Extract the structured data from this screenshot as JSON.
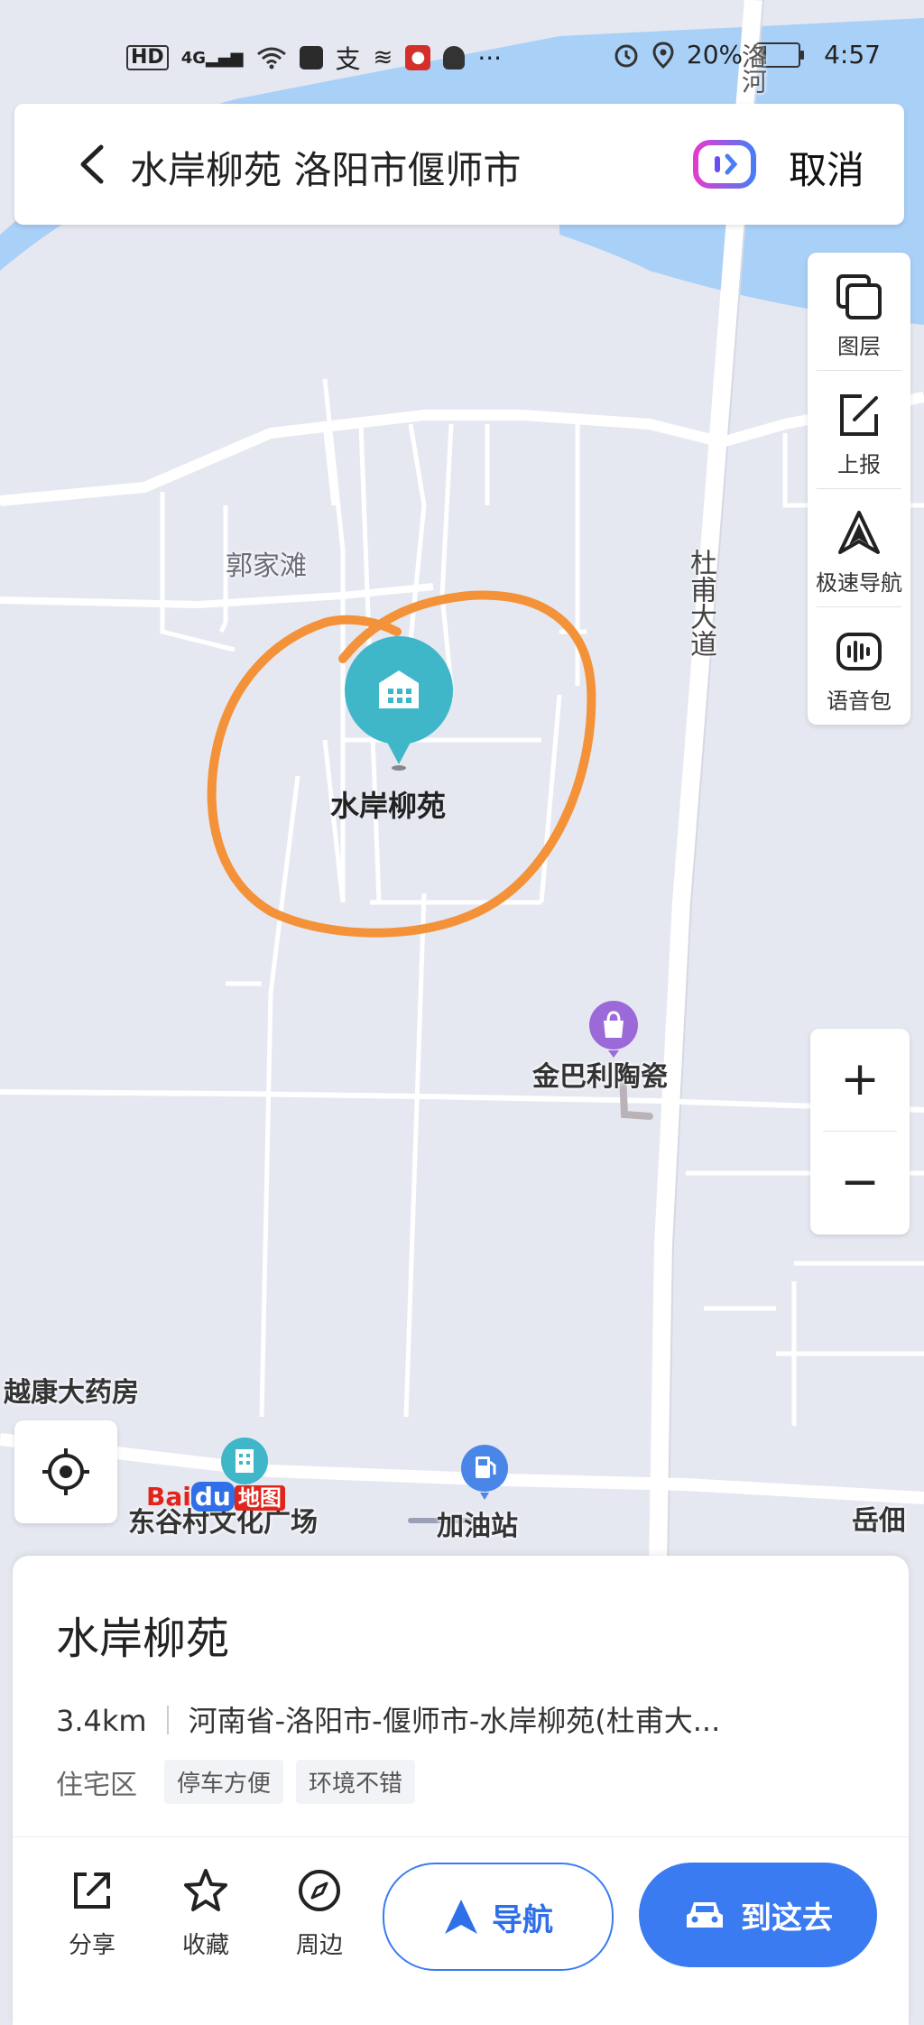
{
  "status_bar": {
    "left_icons": [
      "hd-icon",
      "signal-4g-icon",
      "wifi-icon",
      "app-icon",
      "app-icon-2",
      "app-icon-3",
      "mic-notification-icon",
      "qq-icon",
      "more-dots-icon"
    ],
    "hd_label": "HD",
    "net_label": "4G",
    "more_label": "···",
    "battery": "20%",
    "time": "4:57"
  },
  "search": {
    "query": "水岸柳苑 洛阳市偃师市",
    "cancel_label": "取消"
  },
  "tools": [
    {
      "label": "图层",
      "icon": "layers-icon"
    },
    {
      "label": "上报",
      "icon": "report-edit-icon"
    },
    {
      "label": "极速导航",
      "icon": "fast-navigation-icon"
    },
    {
      "label": "语音包",
      "icon": "voice-pack-icon"
    }
  ],
  "zoom": {
    "in_label": "+",
    "out_label": "−"
  },
  "map": {
    "labels": {
      "village": "郭家滩",
      "road_north": "洛河",
      "road_main": "杜甫大道",
      "shop": "金巴利陶瓷",
      "pharmacy": "越康大药房",
      "plaza": "东谷村文化广场",
      "gas": "加油站",
      "right_edge": "岳佃"
    },
    "selected_poi": "水岸柳苑",
    "baidu_logo_left": "Bai",
    "baidu_logo_mid": "du",
    "baidu_logo_right": "地图",
    "colors": {
      "land": "#e6e8f1",
      "water": "#a9d0f7",
      "road": "#ffffff",
      "pin": "#3fb7c9",
      "circle": "#f4923a",
      "accent": "#3a7bf2"
    }
  },
  "card": {
    "title": "水岸柳苑",
    "distance": "3.4km",
    "address": "河南省-洛阳市-偃师市-水岸柳苑(杜甫大...",
    "category": "住宅区",
    "tags": [
      "停车方便",
      "环境不错"
    ],
    "actions": [
      {
        "label": "分享",
        "icon": "share-icon"
      },
      {
        "label": "收藏",
        "icon": "star-icon"
      },
      {
        "label": "周边",
        "icon": "compass-icon"
      }
    ],
    "navigate_label": "导航",
    "go_label": "到这去"
  }
}
